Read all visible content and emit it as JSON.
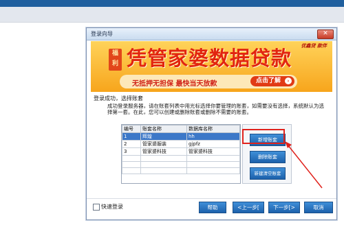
{
  "dialog": {
    "title": "登录向导",
    "close_label": "✕"
  },
  "banner": {
    "brand": "优鑫贷 款伴",
    "badge": [
      "福",
      "利"
    ],
    "headline": "凭管家婆数据贷款",
    "slogan": "无抵押无担保  最快当天放款",
    "button_label": "点击了解",
    "button_icon": "chevron-right-icon"
  },
  "status_heading": "登录成功，选择账套",
  "description": "成功登录服务器，请在账套列表中用光标选择你要管理的账套，如需要没有选择，系统默认为选择第一套。在此，您可以创建或删除账套或删除不需要的账套。",
  "table": {
    "headers": [
      "编号",
      "账套名称",
      "数据库名称"
    ],
    "rows": [
      [
        "1",
        "辉煌",
        "hh"
      ],
      [
        "2",
        "管家婆服装",
        "gjpfz"
      ],
      [
        "3",
        "管家婆科技",
        "管家婆科技"
      ]
    ],
    "selected_index": 0
  },
  "side_buttons": {
    "new": "新增账套",
    "delete": "删除账套",
    "create_empty": "新建清空账套"
  },
  "footer": {
    "quick_login": "快速登录",
    "help": "帮助",
    "prev": "<上一步[",
    "next": "下一步[>",
    "cancel": "取消"
  },
  "colors": {
    "accent": "#1d61ab",
    "highlight": "#e0211b",
    "banner": "#f7a51c"
  }
}
